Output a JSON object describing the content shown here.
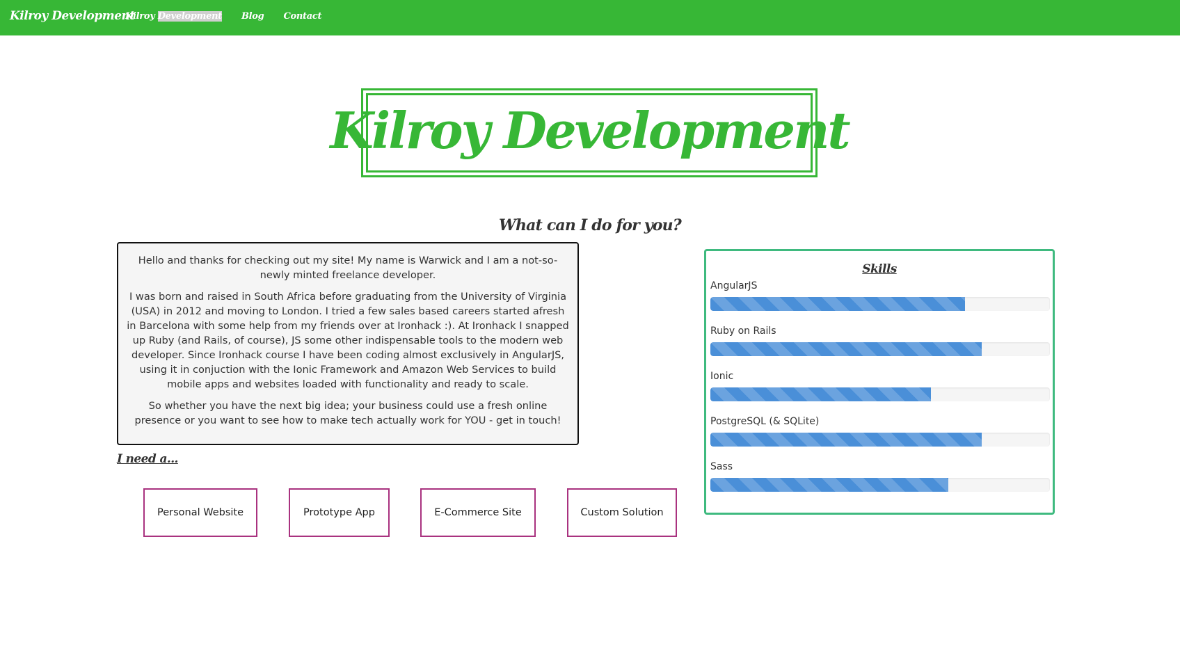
{
  "navbar": {
    "brand": "Kilroy Development",
    "links": [
      {
        "label_prefix": "Kilroy ",
        "label_highlight": "Development"
      },
      {
        "label": "Blog"
      },
      {
        "label": "Contact"
      }
    ],
    "background_color": "#37b736"
  },
  "hero": {
    "title": "Kilroy Development"
  },
  "section_heading": "What can I do for you?",
  "intro": {
    "paragraphs": [
      "Hello and thanks for checking out my site! My name is Warwick and I am a not-so-newly minted freelance developer.",
      "I was born and raised in South Africa before graduating from the University of Virginia (USA) in 2012 and moving to London. I tried a few sales based careers started afresh in Barcelona with some help from my friends over at Ironhack :). At Ironhack I snapped up Ruby (and Rails, of course), JS some other indispensable tools to the modern web developer. Since Ironhack course I have been coding almost exclusively in AngularJS, using it in conjuction with the Ionic Framework and Amazon Web Services to build mobile apps and websites loaded with functionality and ready to scale.",
      "So whether you have the next big idea; your business could use a fresh online presence or you want to see how to make tech actually work for YOU - get in touch!"
    ]
  },
  "need": {
    "heading": "I need a...",
    "options": [
      {
        "label": "Personal Website"
      },
      {
        "label": "Prototype App"
      },
      {
        "label": "E-Commerce Site"
      },
      {
        "label": "Custom Solution"
      }
    ]
  },
  "skills": {
    "title": "Skills",
    "items": [
      {
        "name": "AngularJS",
        "level": 0.75
      },
      {
        "name": "Ruby on Rails",
        "level": 0.8
      },
      {
        "name": "Ionic",
        "level": 0.65
      },
      {
        "name": "PostgreSQL (& SQLite)",
        "level": 0.8
      },
      {
        "name": "Sass",
        "level": 0.7
      }
    ],
    "bar_color": "#4a8fd8",
    "border_color": "#3fba7f"
  },
  "colors": {
    "brand_green": "#37b736",
    "button_border": "#a9327f"
  }
}
